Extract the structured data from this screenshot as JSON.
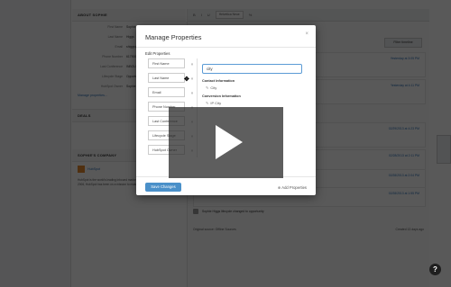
{
  "background": {
    "sidebar_header": "ABOUT SOPHIE",
    "properties": [
      {
        "key": "First Name",
        "value": "Sophie"
      },
      {
        "key": "Last Name",
        "value": "Higgs"
      },
      {
        "key": "Email",
        "value": "shiggs@hubspot"
      },
      {
        "key": "Phone Number",
        "value": "6179007004"
      },
      {
        "key": "Last Conference",
        "value": "INBOUND 13"
      },
      {
        "key": "Lifecycle Stage",
        "value": "Opportunity"
      },
      {
        "key": "HubSpot Owner",
        "value": "Sophie Higgs"
      }
    ],
    "manage_link": "Manage properties...",
    "deals_header": "DEALS",
    "company_header": "SOPHIE'S COMPANY",
    "company_name": "HubSpot",
    "company_about": "HubSpot is the world's leading inbound marketing and sales platform. Since 2006, HubSpot has been on a mission to make the world more inbound.",
    "toolbar": {
      "font": "Helvetica Neue"
    },
    "filter_label": "Filter timeline",
    "feed_times": [
      "Yesterday at 3:05 PM",
      "Yesterday at 4:11 PM",
      "02/29/2013 at 4:23 PM",
      "02/28/2013 at 2:11 PM",
      "02/28/2013 at 2:04 PM",
      "02/28/2013 at 1:55 PM"
    ],
    "lifecycle_row": "Sophie Higgs lifecycle changed to opportunity",
    "original_source_row": "Original source: Offline Sources",
    "created_label": "Created 13 days ago"
  },
  "modal": {
    "title": "Manage Properties",
    "close_glyph": "×",
    "edit_label": "Edit Properties",
    "properties": [
      "First Name",
      "Last Name",
      "Email",
      "Phone Number",
      "Last Conference",
      "Lifecycle Stage",
      "HubSpot Owner"
    ],
    "remove_glyph": "×",
    "search_value": "city",
    "contact_info_header": "Contact Information",
    "contact_info_result": "City",
    "conversion_info_header": "Conversion Information",
    "conversion_info_result": "IP City",
    "save_button": "Save Changes",
    "add_properties": "Add Properties"
  },
  "overlay": {
    "help": "?"
  }
}
